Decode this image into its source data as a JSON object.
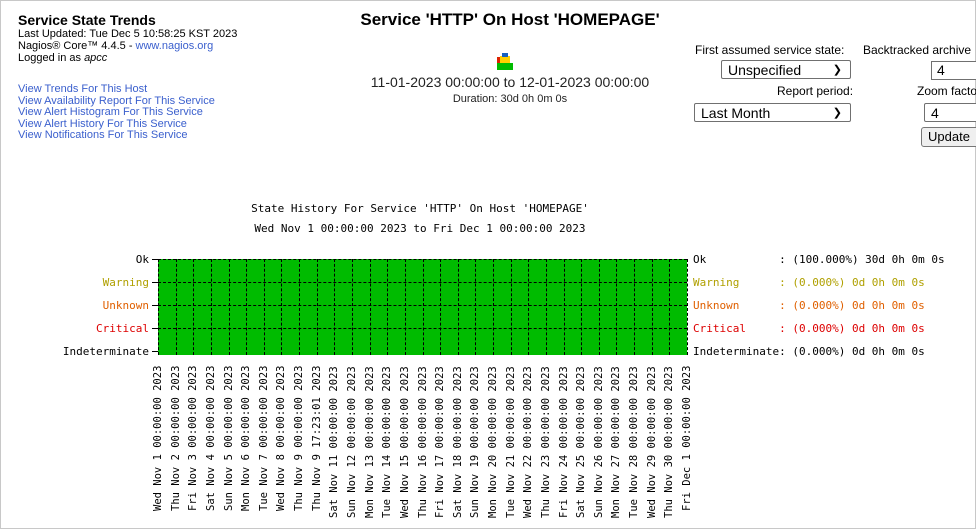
{
  "header": {
    "title": "Service State Trends",
    "last_updated": "Last Updated: Tue Dec 5 10:58:25 KST 2023",
    "core_version_prefix": "Nagios® Core™ 4.4.5 - ",
    "core_link": "www.nagios.org",
    "logged_in_prefix": "Logged in as ",
    "user": "apcc"
  },
  "links": [
    "View Trends For This Host",
    "View Availability Report For This Service",
    "View Alert Histogram For This Service",
    "View Alert History For This Service",
    "View Notifications For This Service"
  ],
  "service": {
    "heading": "Service 'HTTP' On Host 'HOMEPAGE'",
    "range": "11-01-2023 00:00:00 to 12-01-2023 00:00:00",
    "duration": "Duration: 30d 0h 0m 0s"
  },
  "form": {
    "first_state_label": "First assumed service state:",
    "first_state_value": "Unspecified",
    "backtracked_label": "Backtracked archive",
    "backtracked_value": "4",
    "report_period_label": "Report period:",
    "report_period_value": "Last Month",
    "zoom_label": "Zoom facto",
    "zoom_value": "4",
    "update_label": "Update"
  },
  "chart_data": {
    "type": "state-timeline",
    "title": "State History For Service 'HTTP' On Host 'HOMEPAGE'",
    "subtitle": "Wed Nov  1 00:00:00 2023 to Fri Dec  1 00:00:00 2023",
    "states": [
      {
        "name": "Ok",
        "color": "#00aa00"
      },
      {
        "name": "Warning",
        "color": "#b0a000"
      },
      {
        "name": "Unknown",
        "color": "#e06000"
      },
      {
        "name": "Critical",
        "color": "#dd0000"
      },
      {
        "name": "Indeterminate",
        "color": "#000000"
      }
    ],
    "series": [
      {
        "state": "Ok",
        "start": "2023-11-01 00:00:00",
        "end": "2023-12-01 00:00:00"
      }
    ],
    "x_ticks": [
      "Wed Nov  1 00:00:00 2023",
      "Thu Nov  2 00:00:00 2023",
      "Fri Nov  3 00:00:00 2023",
      "Sat Nov  4 00:00:00 2023",
      "Sun Nov  5 00:00:00 2023",
      "Mon Nov  6 00:00:00 2023",
      "Tue Nov  7 00:00:00 2023",
      "Wed Nov  8 00:00:00 2023",
      "Thu Nov  9 00:00:00 2023",
      "Thu Nov  9 17:23:01 2023",
      "Sat Nov 11 00:00:00 2023",
      "Sun Nov 12 00:00:00 2023",
      "Mon Nov 13 00:00:00 2023",
      "Tue Nov 14 00:00:00 2023",
      "Wed Nov 15 00:00:00 2023",
      "Thu Nov 16 00:00:00 2023",
      "Fri Nov 17 00:00:00 2023",
      "Sat Nov 18 00:00:00 2023",
      "Sun Nov 19 00:00:00 2023",
      "Mon Nov 20 00:00:00 2023",
      "Tue Nov 21 00:00:00 2023",
      "Wed Nov 22 00:00:00 2023",
      "Thu Nov 23 00:00:00 2023",
      "Fri Nov 24 00:00:00 2023",
      "Sat Nov 25 00:00:00 2023",
      "Sun Nov 26 00:00:00 2023",
      "Mon Nov 27 00:00:00 2023",
      "Tue Nov 28 00:00:00 2023",
      "Wed Nov 29 00:00:00 2023",
      "Thu Nov 30 00:00:00 2023",
      "Fri Dec  1 00:00:00 2023"
    ],
    "legend": [
      {
        "state": "Ok",
        "text": "Ok           : (100.000%) 30d 0h 0m 0s",
        "color": "#00aa00"
      },
      {
        "state": "Warning",
        "text": "Warning      : (0.000%) 0d 0h 0m 0s",
        "color": "#b0a000"
      },
      {
        "state": "Unknown",
        "text": "Unknown      : (0.000%) 0d 0h 0m 0s",
        "color": "#e06000"
      },
      {
        "state": "Critical",
        "text": "Critical     : (0.000%) 0d 0h 0m 0s",
        "color": "#dd0000"
      },
      {
        "state": "Indeterminate",
        "text": "Indeterminate: (0.000%) 0d 0h 0m 0s",
        "color": "#000000"
      }
    ]
  }
}
